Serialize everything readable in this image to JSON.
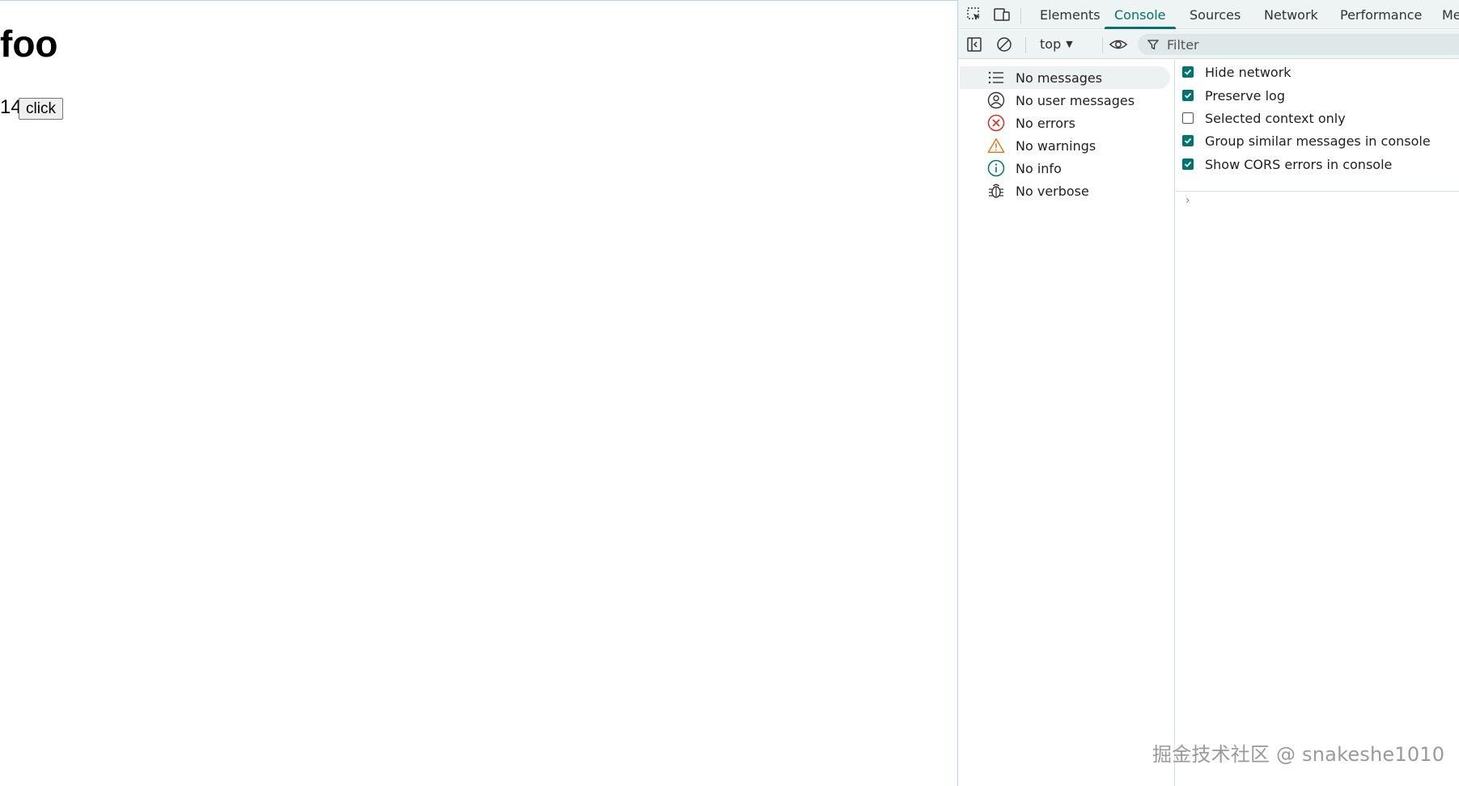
{
  "page": {
    "heading": "foo",
    "count": "14",
    "button_label": "click"
  },
  "devtools": {
    "tabs": [
      {
        "label": "Elements"
      },
      {
        "label": "Console",
        "active": true
      },
      {
        "label": "Sources"
      },
      {
        "label": "Network"
      },
      {
        "label": "Performance"
      },
      {
        "label": "Me"
      }
    ],
    "toolbar": {
      "context": "top",
      "filter_placeholder": "Filter"
    },
    "sidebar": {
      "items": [
        {
          "label": "No messages",
          "icon": "list-icon",
          "selected": true
        },
        {
          "label": "No user messages",
          "icon": "user-icon"
        },
        {
          "label": "No errors",
          "icon": "error-icon"
        },
        {
          "label": "No warnings",
          "icon": "warning-icon"
        },
        {
          "label": "No info",
          "icon": "info-icon"
        },
        {
          "label": "No verbose",
          "icon": "bug-icon"
        }
      ]
    },
    "settings": [
      {
        "label": "Hide network",
        "checked": true
      },
      {
        "label": "Preserve log",
        "checked": true
      },
      {
        "label": "Selected context only",
        "checked": false
      },
      {
        "label": "Group similar messages in console",
        "checked": true
      },
      {
        "label": "Show CORS errors in console",
        "checked": true
      }
    ],
    "prompt_symbol": "›"
  },
  "colors": {
    "accent": "#00756c",
    "error": "#d93025",
    "warning": "#e8710a",
    "info": "#00756c"
  },
  "watermark": "掘金技术社区 @ snakeshe1010"
}
